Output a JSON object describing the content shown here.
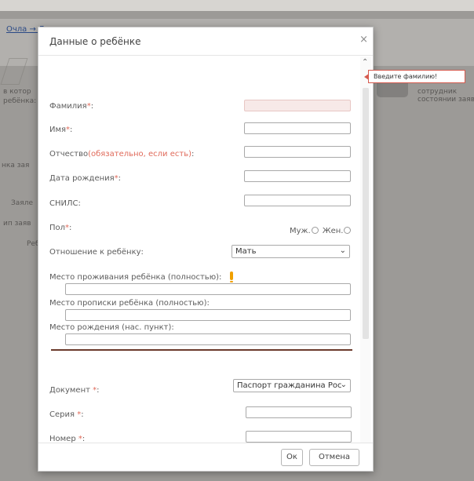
{
  "background": {
    "breadcrumb": "Очла → Д",
    "left_labels": [
      "в котор",
      "ребёнка:",
      "нка зая",
      "Заяле",
      "ип заяв",
      "Реб"
    ],
    "right_labels": [
      "сотрудник",
      "состоянии заявл"
    ]
  },
  "modal": {
    "title": "Данные о ребёнке",
    "close_symbol": "×",
    "fields": {
      "surname_label": "Фамилия",
      "name_label": "Имя",
      "patronymic_label": "Отчество",
      "patronymic_hint": "(обязательно, если есть)",
      "birthdate_label": "Дата рождения",
      "snils_label": "СНИЛС:",
      "gender_label": "Пол",
      "gender_male": "Муж.",
      "gender_female": "Жен.",
      "relation_label": "Отношение к ребёнку:",
      "relation_value": "Мать",
      "residence_label": "Место проживания ребёнка (полностью):",
      "registration_label": "Место прописки ребёнка (полностью):",
      "birthplace_label": "Место рождения (нас. пункт):",
      "document_label": "Документ",
      "document_value": "Паспорт гражданина Рос",
      "series_label": "Серия",
      "number_label": "Номер"
    },
    "required_mark": "*",
    "colon": ":",
    "tooltip": "Введите фамилию!",
    "buttons": {
      "ok": "Ок",
      "cancel": "Отмена"
    }
  }
}
